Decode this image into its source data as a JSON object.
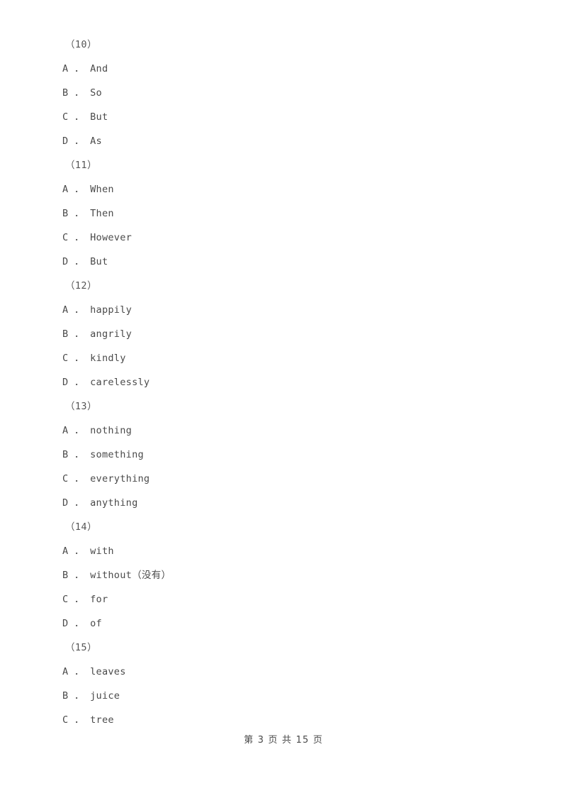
{
  "document": {
    "page_background": "#ffffff",
    "text_color": "#4a4a4a"
  },
  "questions": [
    {
      "number": "（10）",
      "options": [
        "A ． And",
        "B ． So",
        "C ． But",
        "D ． As"
      ]
    },
    {
      "number": "（11）",
      "options": [
        "A ． When",
        "B ． Then",
        "C ． However",
        "D ． But"
      ]
    },
    {
      "number": "（12）",
      "options": [
        "A ． happily",
        "B ． angrily",
        "C ． kindly",
        "D ． carelessly"
      ]
    },
    {
      "number": "（13）",
      "options": [
        "A ． nothing",
        "B ． something",
        "C ． everything",
        "D ． anything"
      ]
    },
    {
      "number": "（14）",
      "options": [
        "A ． with",
        "B ． without（没有）",
        "C ． for",
        "D ． of"
      ]
    },
    {
      "number": "（15）",
      "options": [
        "A ． leaves",
        "B ． juice",
        "C ． tree"
      ]
    }
  ],
  "footer": {
    "text": "第 3 页 共 15 页"
  }
}
